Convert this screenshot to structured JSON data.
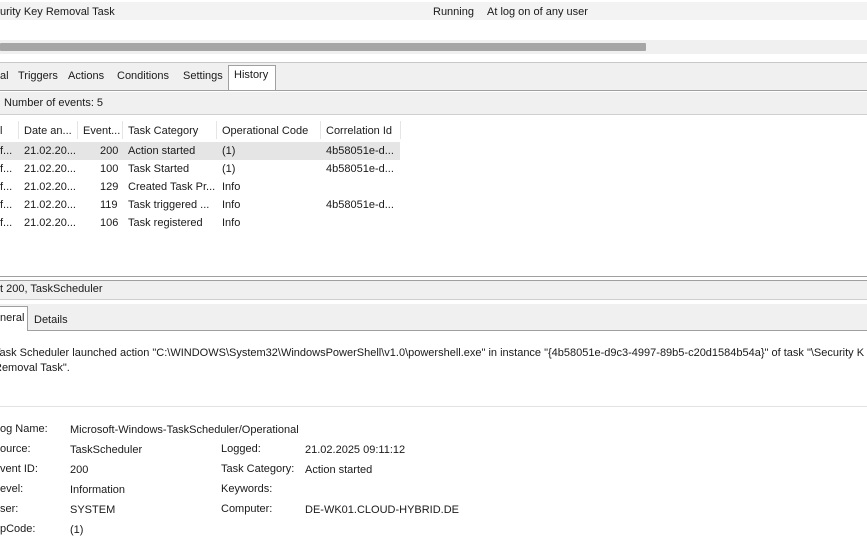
{
  "task_row": {
    "name": "urity Key Removal Task",
    "status": "Running",
    "trigger": "At log on of any user"
  },
  "tabs": [
    {
      "label": "al"
    },
    {
      "label": "Triggers"
    },
    {
      "label": "Actions"
    },
    {
      "label": "Conditions"
    },
    {
      "label": "Settings"
    },
    {
      "label": "History",
      "active": true
    }
  ],
  "history": {
    "count_label": "Number of events: 5",
    "columns": [
      "l",
      "Date an...",
      "Event...",
      "Task Category",
      "Operational Code",
      "Correlation Id"
    ],
    "rows": [
      {
        "level": "f...",
        "date": "21.02.20...",
        "event": "200",
        "category": "Action started",
        "opcode": "(1)",
        "correlation": "4b58051e-d...",
        "selected": true
      },
      {
        "level": "f...",
        "date": "21.02.20...",
        "event": "100",
        "category": "Task Started",
        "opcode": "(1)",
        "correlation": "4b58051e-d..."
      },
      {
        "level": "f...",
        "date": "21.02.20...",
        "event": "129",
        "category": "Created Task Pr...",
        "opcode": "Info",
        "correlation": ""
      },
      {
        "level": "f...",
        "date": "21.02.20...",
        "event": "119",
        "category": "Task triggered ...",
        "opcode": "Info",
        "correlation": "4b58051e-d..."
      },
      {
        "level": "f...",
        "date": "21.02.20...",
        "event": "106",
        "category": "Task registered",
        "opcode": "Info",
        "correlation": ""
      }
    ]
  },
  "event_detail": {
    "header": "t 200, TaskScheduler",
    "tabs": [
      "neral",
      "Details"
    ],
    "description": "Task Scheduler launched action \"C:\\WINDOWS\\System32\\WindowsPowerShell\\v1.0\\powershell.exe\" in instance \"{4b58051e-d9c3-4997-89b5-c20d1584b54a}\" of task \"\\Security K Removal Task\".",
    "fields": {
      "log_name_label": "og Name:",
      "log_name": "Microsoft-Windows-TaskScheduler/Operational",
      "source_label": "ource:",
      "source": "TaskScheduler",
      "logged_label": "Logged:",
      "logged": "21.02.2025 09:11:12",
      "event_id_label": "vent ID:",
      "event_id": "200",
      "task_category_label": "Task Category:",
      "task_category": "Action started",
      "level_label": "evel:",
      "level": "Information",
      "keywords_label": "Keywords:",
      "keywords": "",
      "user_label": "ser:",
      "user": "SYSTEM",
      "computer_label": "Computer:",
      "computer": "DE-WK01.CLOUD-HYBRID.DE",
      "opcode_label": "pCode:",
      "opcode": "(1)"
    }
  }
}
